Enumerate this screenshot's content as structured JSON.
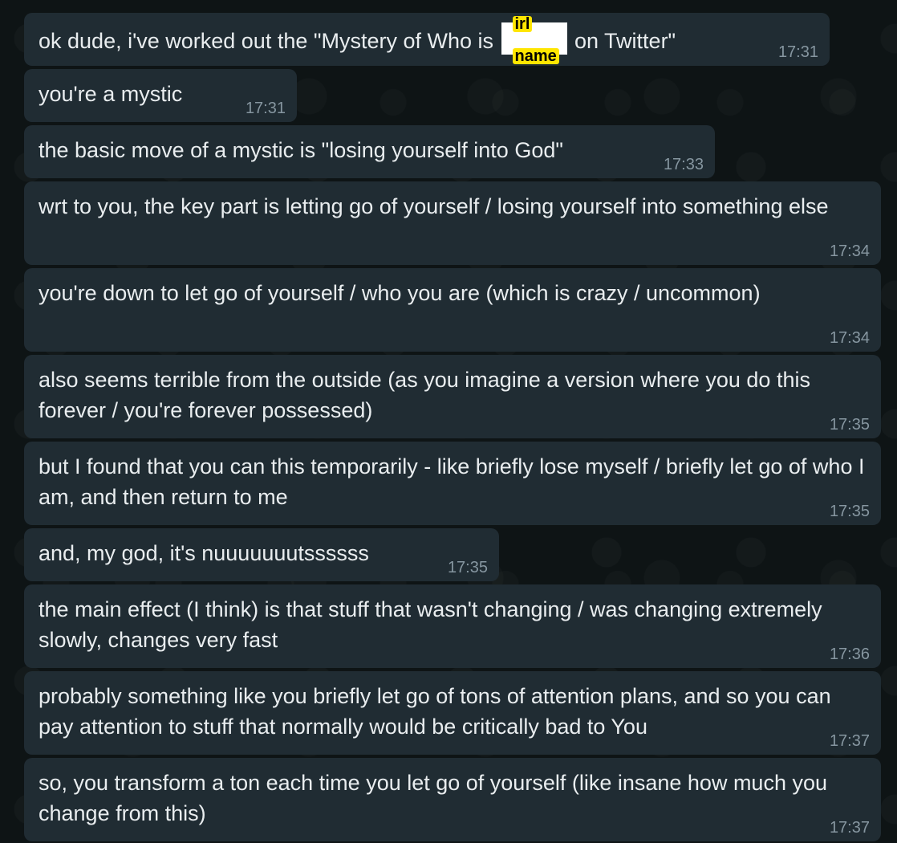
{
  "messages": [
    {
      "pre": "ok dude, i've worked out the \"Mystery of Who is ",
      "redaction": {
        "label_top": "irl",
        "label_bottom": "name"
      },
      "post": " on Twitter\"",
      "time": "17:31"
    },
    {
      "text": "you're a mystic",
      "time": "17:31"
    },
    {
      "text": "the basic move of a mystic is \"losing yourself into God\"",
      "time": "17:33"
    },
    {
      "text": "wrt to you, the key part is letting go of yourself / losing yourself into something else",
      "time": "17:34"
    },
    {
      "text": "you're down to let go of yourself / who you are (which is crazy / uncommon)",
      "time": "17:34"
    },
    {
      "text": "also seems terrible from the outside (as you imagine a version where you do this forever / you're forever possessed)",
      "time": "17:35"
    },
    {
      "text": "but I found that you can this temporarily - like briefly lose myself / briefly let go of who I am, and then return to me",
      "time": "17:35"
    },
    {
      "text": "and, my god, it's nuuuuuuutssssss",
      "time": "17:35"
    },
    {
      "text": "the main effect (I think) is that stuff that wasn't changing / was changing extremely slowly, changes very fast",
      "time": "17:36"
    },
    {
      "text": "probably something like you briefly let go of tons of attention plans, and so you can pay attention to stuff that normally would be critically bad to You",
      "time": "17:37"
    },
    {
      "text": "so, you transform a ton each time you let go of yourself (like insane how much you change from this)",
      "time": "17:37"
    }
  ],
  "colors": {
    "background": "#0e1415",
    "bubble": "#202c33",
    "text": "#e9edef",
    "timestamp": "#8696a0",
    "redaction_fill": "#ffffff",
    "redaction_label": "#ffe600"
  }
}
